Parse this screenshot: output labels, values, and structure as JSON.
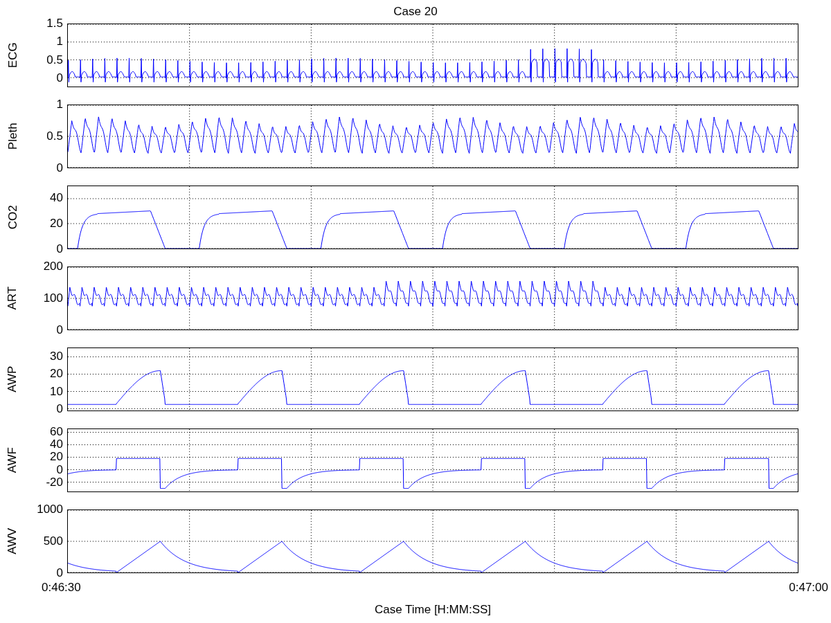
{
  "title": "Case 20",
  "panels": [
    {
      "kind": "ecg",
      "ylabel": "ECG",
      "ytick_labels": [
        "1.5",
        "1",
        "0.5",
        "0"
      ]
    },
    {
      "kind": "pleth",
      "ylabel": "Pleth",
      "ytick_labels": [
        "1",
        "0.5",
        "0"
      ]
    },
    {
      "kind": "co2",
      "ylabel": "CO2",
      "ytick_labels": [
        "40",
        "20",
        "0"
      ]
    },
    {
      "kind": "art",
      "ylabel": "ART",
      "ytick_labels": [
        "200",
        "100",
        "0"
      ]
    },
    {
      "kind": "awp",
      "ylabel": "AWP",
      "ytick_labels": [
        "30",
        "20",
        "10",
        "0"
      ]
    },
    {
      "kind": "awf",
      "ylabel": "AWF",
      "ytick_labels": [
        "60",
        "40",
        "20",
        "0",
        "-20"
      ]
    },
    {
      "kind": "awv",
      "ylabel": "AWV",
      "ytick_labels": [
        "1000",
        "500",
        "0"
      ]
    }
  ],
  "x_axis": {
    "label": "Case Time [H:MM:SS]",
    "tick_labels": [
      "0:46:30",
      "0:47:00"
    ]
  }
}
